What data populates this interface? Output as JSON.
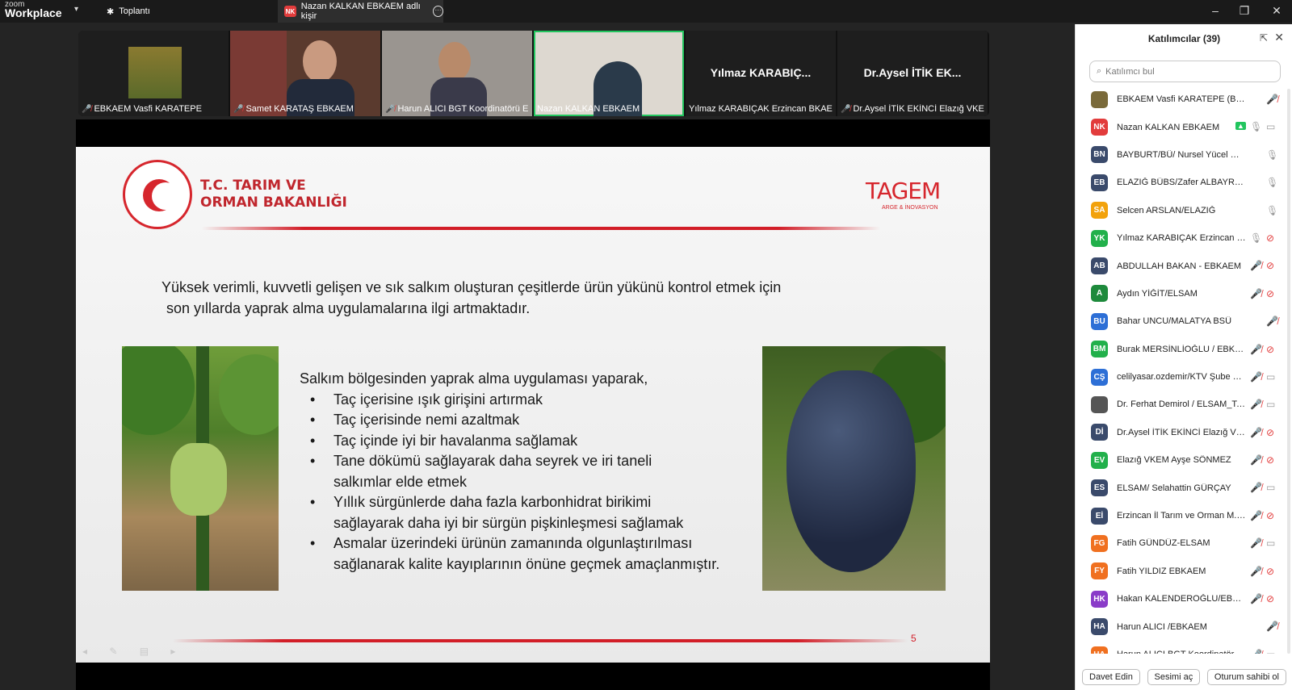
{
  "titlebar": {
    "brand_small": "zoom",
    "brand_large": "Workplace",
    "meeting_tab": "Toplantı",
    "share_tab_badge": "NK",
    "share_tab_label": "Nazan KALKAN EBKAEM adlı kişir",
    "minimize": "–",
    "maximize": "❐",
    "close": "✕"
  },
  "video_strip": [
    {
      "name": "EBKAEM Vasfi KARATEPE",
      "muted": true
    },
    {
      "name": "Samet KARATAŞ EBKAEM",
      "muted": true
    },
    {
      "name": "Harun ALICI BGT Koordinatörü E...",
      "muted": true
    },
    {
      "name": "Nazan KALKAN EBKAEM",
      "muted": false,
      "active": true
    },
    {
      "name": "Yılmaz KARABIÇAK Erzincan BKAE",
      "big": "Yılmaz KARABIÇ...",
      "muted": false
    },
    {
      "name": "Dr.Aysel İTİK EKİNCİ Elazığ VKE",
      "big": "Dr.Aysel İTİK EK...",
      "muted": true
    }
  ],
  "slide": {
    "ministry_line1": "T.C. TARIM VE",
    "ministry_line2": "ORMAN BAKANLIĞI",
    "tagem": "TAGEM",
    "tagem_sub": "ARGE & İNOVASYON",
    "intro_line1": "Yüksek verimli, kuvvetli gelişen ve sık salkım oluşturan çeşitlerde ürün yükünü kontrol etmek için",
    "intro_line2": "son yıllarda yaprak alma uygulamalarına ilgi artmaktadır.",
    "lead": "Salkım bölgesinden yaprak alma uygulaması yaparak,",
    "b1": "Taç içerisine ışık girişini artırmak",
    "b2": "Taç içerisinde nemi azaltmak",
    "b3": "Taç içinde iyi bir havalanma sağlamak",
    "b4a": "Tane dökümü sağlayarak daha seyrek ve iri taneli",
    "b4b": "salkımlar elde etmek",
    "b5a": "Yıllık sürgünlerde daha fazla karbonhidrat birikimi",
    "b5b": "sağlayarak daha iyi bir sürgün pişkinleşmesi sağlamak",
    "b6a": "Asmalar üzerindeki ürünün zamanında olgunlaştırılması",
    "b6b": "sağlanarak kalite kayıplarının önüne geçmek amaçlanmıştır.",
    "page_number": "5"
  },
  "panel": {
    "title": "Katılımcılar (39)",
    "search_placeholder": "Katılımcı bul",
    "participants": [
      {
        "initials": "",
        "color": "#7a6a3a",
        "name": "EBKAEM Vasfi KARATEPE (Ben)",
        "mic": "muted",
        "cam": "none"
      },
      {
        "initials": "NK",
        "color": "#e23c3c",
        "name": "Nazan KALKAN EBKAEM",
        "mic": "on",
        "cam": "on",
        "share": true
      },
      {
        "initials": "BN",
        "color": "#3a4a6b",
        "name": "BAYBURT/BÜ/ Nursel  Yücel Osman...",
        "mic": "on",
        "cam": "none"
      },
      {
        "initials": "EB",
        "color": "#3a4a6b",
        "name": "ELAZIĞ BÜBS/Zafer ALBAYRAK",
        "mic": "on",
        "cam": "none"
      },
      {
        "initials": "SA",
        "color": "#f2a20c",
        "name": "Selcen ARSLAN/ELAZIĞ",
        "mic": "on",
        "cam": "none"
      },
      {
        "initials": "YK",
        "color": "#22b04b",
        "name": "Yılmaz KARABIÇAK Erzincan BK...",
        "mic": "on",
        "cam": "muted"
      },
      {
        "initials": "AB",
        "color": "#3a4a6b",
        "name": "ABDULLAH BAKAN - EBKAEM",
        "mic": "muted",
        "cam": "muted"
      },
      {
        "initials": "A",
        "color": "#1e8a3c",
        "name": "Aydın YİĞİT/ELSAM",
        "mic": "muted",
        "cam": "muted"
      },
      {
        "initials": "BU",
        "color": "#2d6fd6",
        "name": "Bahar UNCU/MALATYA BSÜ",
        "mic": "muted",
        "cam": "none"
      },
      {
        "initials": "BM",
        "color": "#22b04b",
        "name": "Burak MERSİNLİOĞLU / EBKAEM",
        "mic": "muted",
        "cam": "muted"
      },
      {
        "initials": "CŞ",
        "color": "#2d6fd6",
        "name": "celilyasar.ozdemir/KTV Şube M...",
        "mic": "muted",
        "cam": "off"
      },
      {
        "initials": "",
        "color": "#555555",
        "name": "Dr. Ferhat Demirol / ELSAM_Te...",
        "mic": "muted",
        "cam": "off"
      },
      {
        "initials": "Dİ",
        "color": "#3a4a6b",
        "name": "Dr.Aysel İTİK EKİNCİ Elazığ VKE",
        "mic": "muted",
        "cam": "muted"
      },
      {
        "initials": "EV",
        "color": "#22b04b",
        "name": "Elazığ VKEM Ayşe SÖNMEZ",
        "mic": "muted",
        "cam": "muted"
      },
      {
        "initials": "ES",
        "color": "#3a4a6b",
        "name": "ELSAM/ Selahattin GÜRÇAY",
        "mic": "muted",
        "cam": "off"
      },
      {
        "initials": "Eİ",
        "color": "#3a4a6b",
        "name": "Erzincan İl Tarım ve Orman M. ...",
        "mic": "muted",
        "cam": "muted"
      },
      {
        "initials": "FG",
        "color": "#f07020",
        "name": "Fatih GÜNDÜZ-ELSAM",
        "mic": "muted",
        "cam": "off"
      },
      {
        "initials": "FY",
        "color": "#f07020",
        "name": "Fatih YILDIZ EBKAEM",
        "mic": "muted",
        "cam": "muted"
      },
      {
        "initials": "HK",
        "color": "#8a3cc8",
        "name": "Hakan KALENDEROĞLU/EBKAEM",
        "mic": "muted",
        "cam": "muted"
      },
      {
        "initials": "HA",
        "color": "#3a4a6b",
        "name": "Harun ALICI /EBKAEM",
        "mic": "muted",
        "cam": "none"
      },
      {
        "initials": "HA",
        "color": "#f07020",
        "name": "Harun ALICI BGT Koordinatörü ...",
        "mic": "muted",
        "cam": "off"
      }
    ],
    "invite": "Davet Edin",
    "unmute": "Sesimi aç",
    "claim_host": "Oturum sahibi ol"
  }
}
